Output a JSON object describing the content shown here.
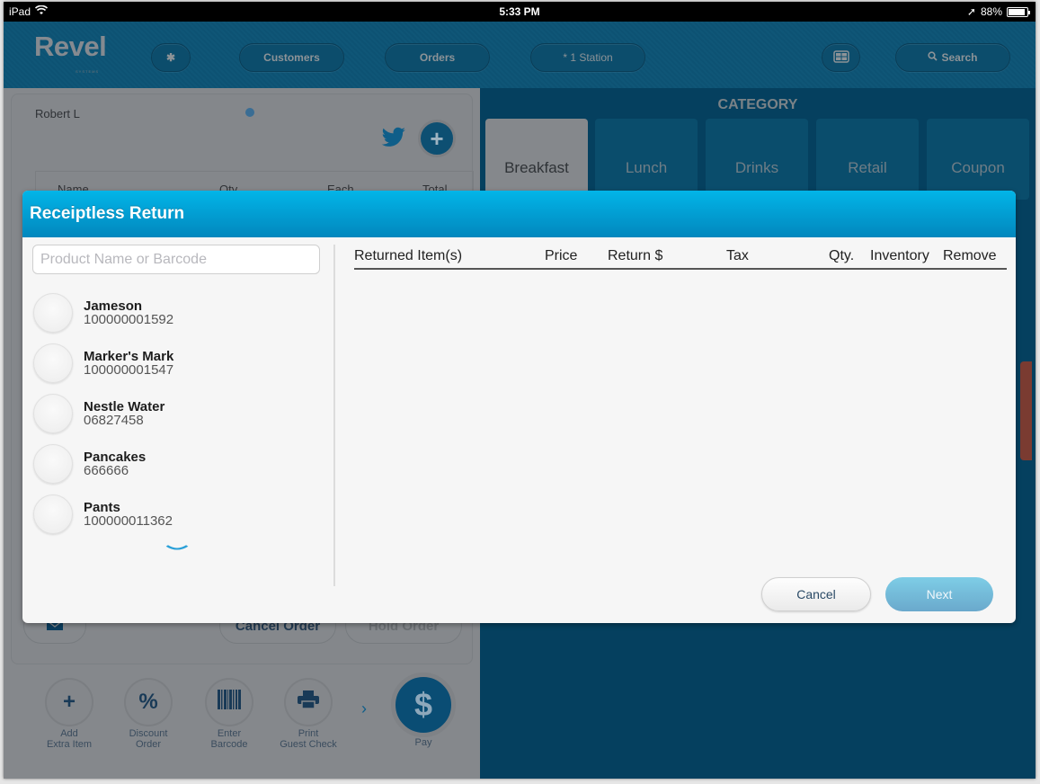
{
  "statusbar": {
    "device": "iPad",
    "time": "5:33 PM",
    "battery": "88%",
    "battery_level": 0.88
  },
  "topnav": {
    "logo": "Revel",
    "logo_sub": "SYSTEMS",
    "settings_icon": "gear-icon",
    "customers": "Customers",
    "orders": "Orders",
    "station": "* 1 Station",
    "layout_icon": "grid-layout-icon",
    "search": "Search"
  },
  "order": {
    "customer": "Robert L",
    "columns": [
      "Name",
      "Qty",
      "Each",
      "Total"
    ],
    "cancel_order": "Cancel Order",
    "hold_order": "Hold Order",
    "tools": [
      {
        "icon": "+",
        "label_1": "Add",
        "label_2": "Extra Item"
      },
      {
        "icon": "%",
        "label_1": "Discount",
        "label_2": "Order"
      },
      {
        "icon": "barcode",
        "label_1": "Enter",
        "label_2": "Barcode"
      },
      {
        "icon": "printer",
        "label_1": "Print",
        "label_2": "Guest Check"
      }
    ],
    "pay_symbol": "$",
    "pay_label": "Pay"
  },
  "category": {
    "title": "CATEGORY",
    "tabs": [
      "Breakfast",
      "Lunch",
      "Drinks",
      "Retail",
      "Coupon"
    ],
    "active": "Breakfast"
  },
  "modal": {
    "title": "Receiptless Return",
    "search_placeholder": "Product Name or Barcode",
    "search_value": "",
    "products": [
      {
        "name": "Jameson",
        "code": "100000001592"
      },
      {
        "name": "Marker's Mark",
        "code": "100000001547"
      },
      {
        "name": "Nestle Water",
        "code": "06827458"
      },
      {
        "name": "Pancakes",
        "code": "666666"
      },
      {
        "name": "Pants",
        "code": "100000011362"
      }
    ],
    "columns": [
      "Returned Item(s)",
      "Price",
      "Return $",
      "Tax",
      "Qty.",
      "Inventory",
      "Remove"
    ],
    "returned_items": [],
    "cancel": "Cancel",
    "next": "Next"
  },
  "colors": {
    "accent": "#02b5e8",
    "nav_bg": "#0f5677",
    "next_button": "#7ecde6"
  }
}
